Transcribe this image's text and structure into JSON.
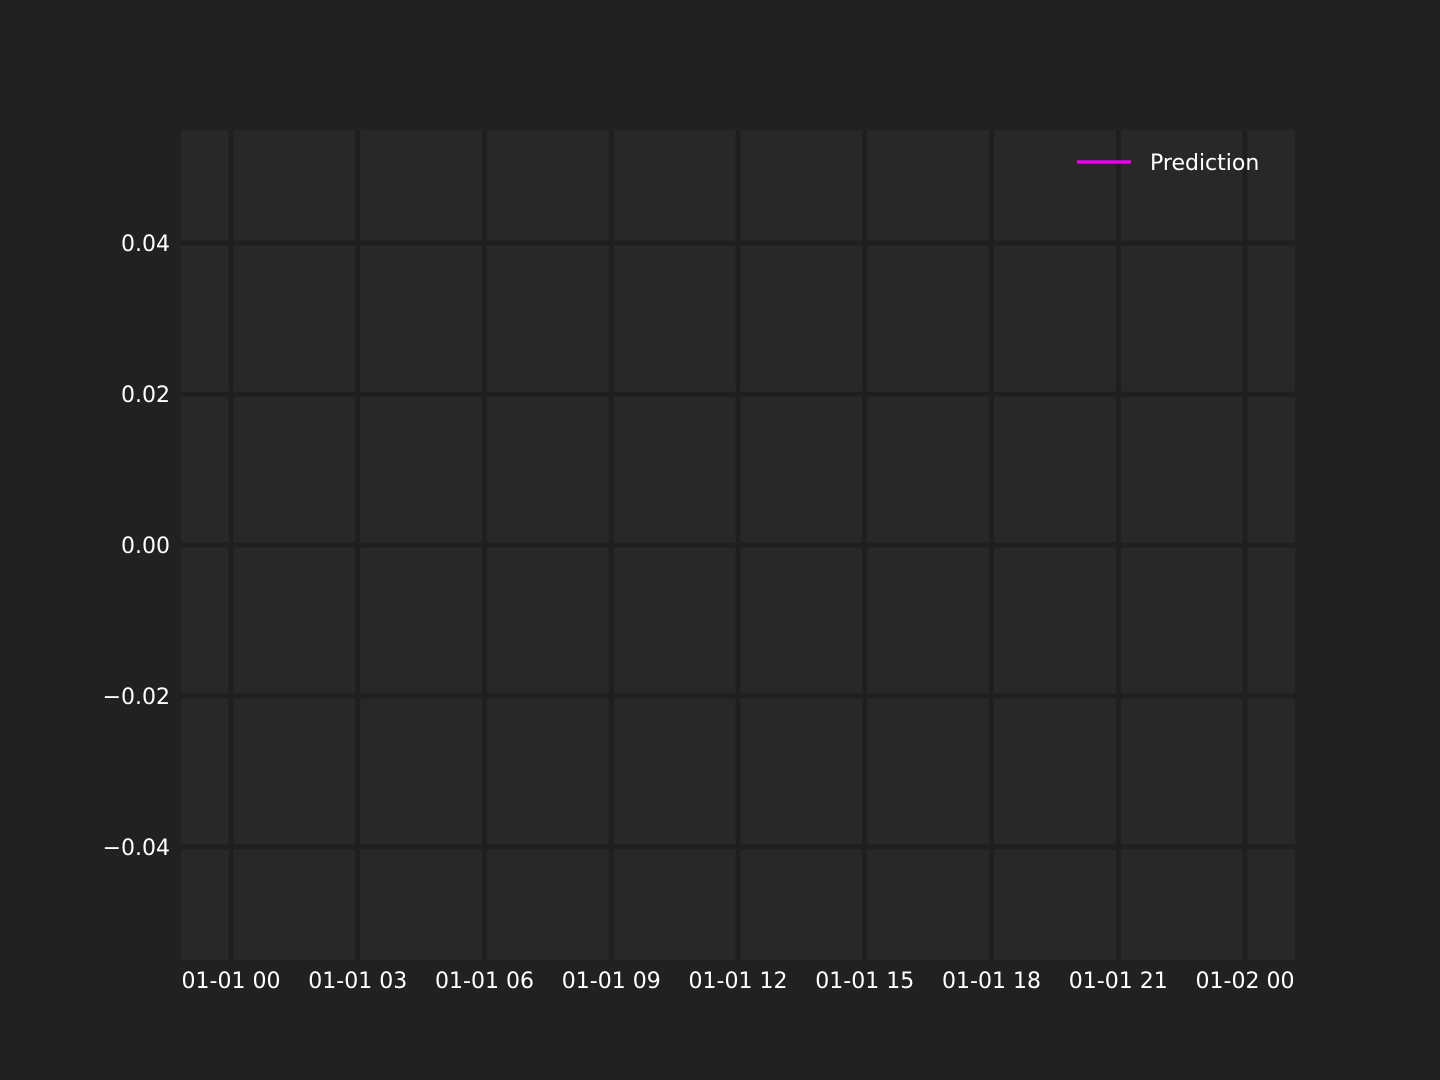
{
  "chart_data": {
    "type": "line",
    "title": "",
    "xlabel": "",
    "ylabel": "",
    "x_axis_type": "datetime",
    "xlim": [
      "01-01 00",
      "01-02 00"
    ],
    "ylim": [
      -0.055,
      0.055
    ],
    "x_tick_labels": [
      "01-01 00",
      "01-01 03",
      "01-01 06",
      "01-01 09",
      "01-01 12",
      "01-01 15",
      "01-01 18",
      "01-01 21",
      "01-02 00"
    ],
    "y_ticks": [
      -0.04,
      -0.02,
      0.0,
      0.02,
      0.04
    ],
    "y_tick_labels": [
      "−0.04",
      "−0.02",
      "0.00",
      "0.02",
      "0.04"
    ],
    "grid": true,
    "legend_position": "top-right",
    "series": [
      {
        "name": "Prediction",
        "color": "#e600e6",
        "values": []
      }
    ]
  },
  "colors": {
    "page_background": "#212121",
    "plot_background": "#282828",
    "grid": "#1f1f1f",
    "text": "#ffffff"
  }
}
